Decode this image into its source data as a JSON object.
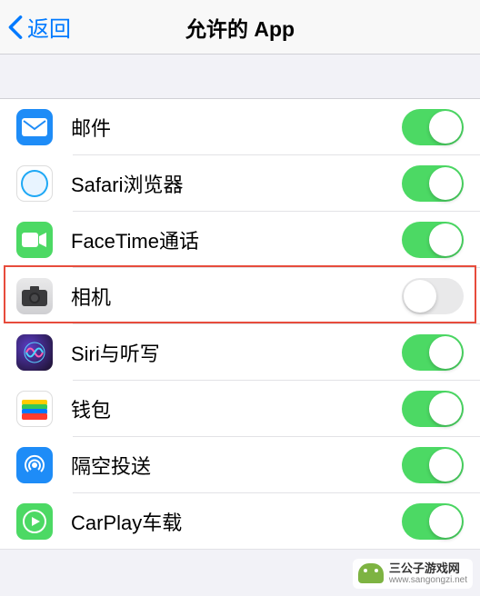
{
  "navbar": {
    "back": "返回",
    "title": "允许的 App"
  },
  "apps": [
    {
      "id": "mail",
      "label": "邮件",
      "icon": "mail-icon",
      "enabled": true
    },
    {
      "id": "safari",
      "label": "Safari浏览器",
      "icon": "safari-icon",
      "enabled": true
    },
    {
      "id": "facetime",
      "label": "FaceTime通话",
      "icon": "facetime-icon",
      "enabled": true
    },
    {
      "id": "camera",
      "label": "相机",
      "icon": "camera-icon",
      "enabled": false
    },
    {
      "id": "siri",
      "label": "Siri与听写",
      "icon": "siri-icon",
      "enabled": true
    },
    {
      "id": "wallet",
      "label": "钱包",
      "icon": "wallet-icon",
      "enabled": true
    },
    {
      "id": "airdrop",
      "label": "隔空投送",
      "icon": "airdrop-icon",
      "enabled": true
    },
    {
      "id": "carplay",
      "label": "CarPlay车载",
      "icon": "carplay-icon",
      "enabled": true
    }
  ],
  "highlight_index": 3,
  "watermark": {
    "main": "三公子游戏网",
    "sub": "www.sangongzi.net"
  }
}
